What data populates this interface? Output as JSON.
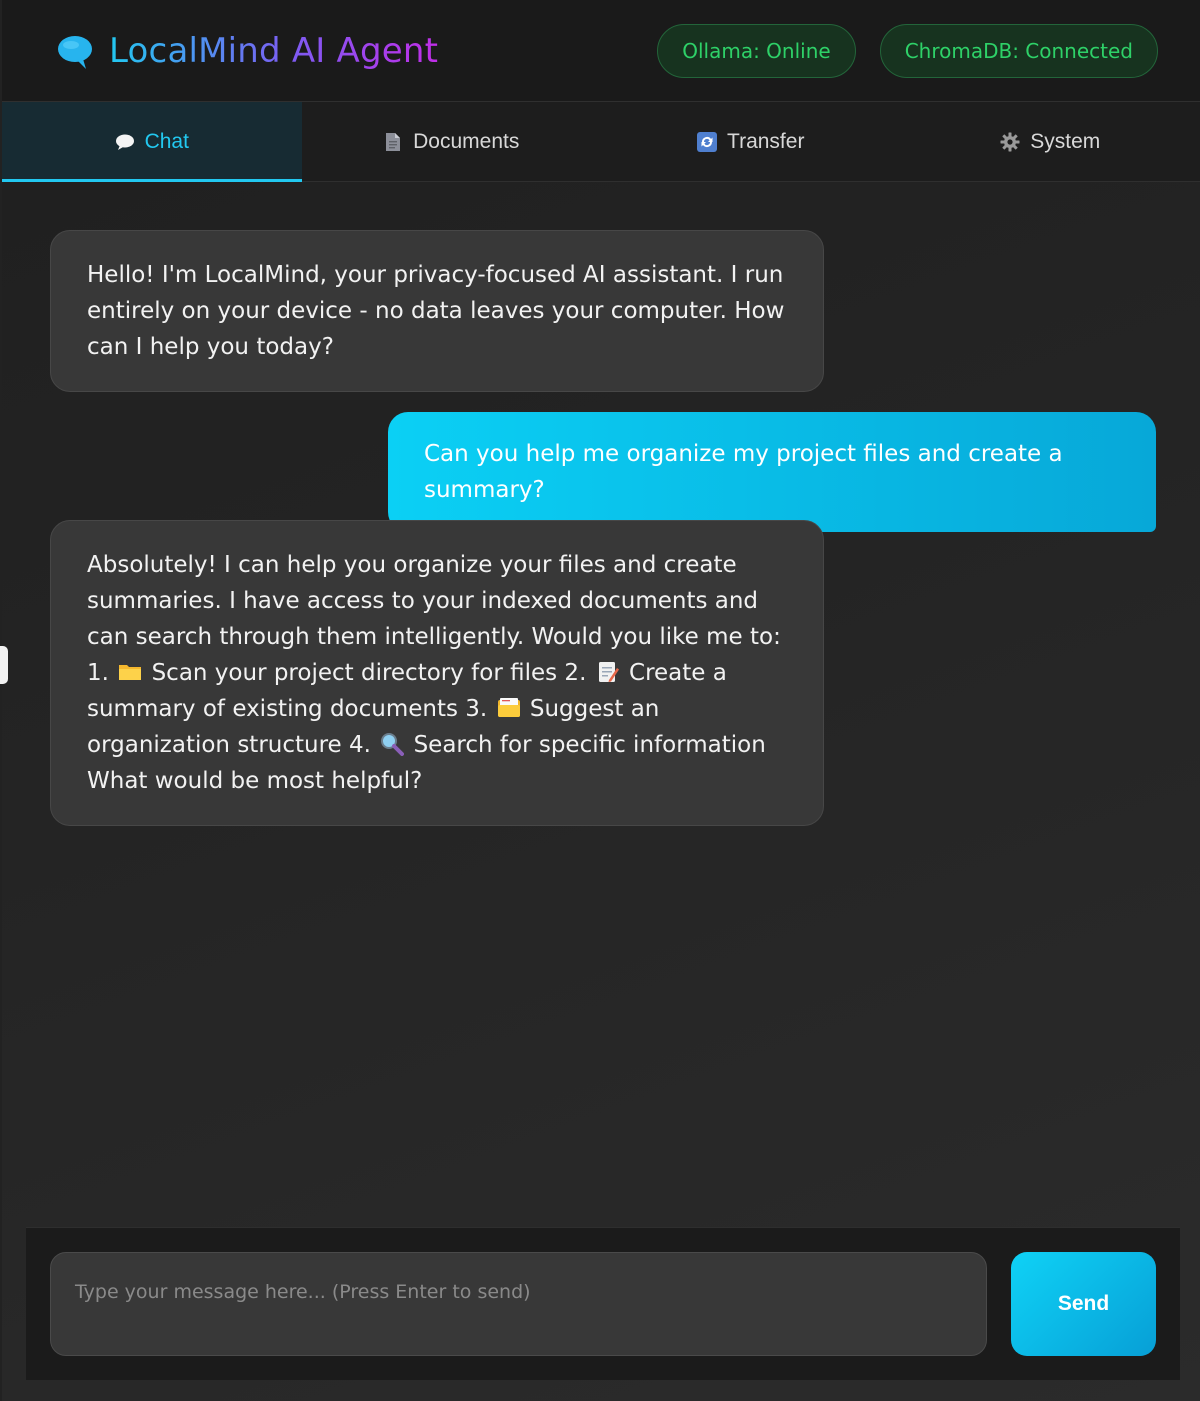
{
  "app": {
    "title": "LocalMind AI Agent",
    "logo_icon": "speech-bubble-icon",
    "accent_color": "#22c8f0",
    "title_gradient": [
      "#22c8f0",
      "#7d5cf2",
      "#c02ee8"
    ]
  },
  "status": {
    "ollama": "Ollama: Online",
    "chromadb": "ChromaDB: Connected",
    "color": "#2ed168"
  },
  "tabs": [
    {
      "label": "Chat",
      "icon": "speech-bubble-icon",
      "active": true
    },
    {
      "label": "Documents",
      "icon": "document-icon",
      "active": false
    },
    {
      "label": "Transfer",
      "icon": "transfer-icon",
      "active": false
    },
    {
      "label": "System",
      "icon": "gear-icon",
      "active": false
    }
  ],
  "messages": [
    {
      "role": "assistant",
      "text": "Hello! I'm LocalMind, your privacy-focused AI assistant. I run entirely on your device - no data leaves your computer. How can I help you today?"
    },
    {
      "role": "user",
      "text": "Can you help me organize my project files and create a summary?"
    },
    {
      "role": "assistant",
      "parts": {
        "p1": "Absolutely! I can help you organize your files and create summaries. I have access to your indexed documents and can search through them intelligently. Would you like me to: 1.",
        "p2": "Scan your project directory for files 2.",
        "p3": "Create a summary of existing documents 3.",
        "p4": "Suggest an organization structure 4.",
        "p5": "Search for specific information What would be most helpful?"
      },
      "emoji_icons": [
        "folder-icon",
        "memo-icon",
        "card-index-icon",
        "magnifier-icon"
      ]
    }
  ],
  "input": {
    "placeholder": "Type your message here... (Press Enter to send)",
    "value": ""
  },
  "send_button": {
    "label": "Send"
  }
}
